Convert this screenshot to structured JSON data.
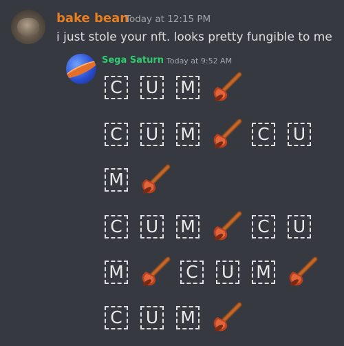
{
  "messages": [
    {
      "author": "bake bean",
      "author_color": "#e67e22",
      "timestamp": "Today at 12:15 PM",
      "text": "i just stole your nft. looks pretty fungible to me",
      "avatar_icon": "user-avatar-photo"
    },
    {
      "author": "Sega Saturn",
      "author_color": "#2ecc71",
      "timestamp": "Today at 9:52 AM",
      "avatar_icon": "saturn-planet-avatar",
      "rows": [
        [
          "C",
          "U",
          "M",
          "plunger"
        ],
        [
          "C",
          "U",
          "M",
          "plunger",
          "C",
          "U"
        ],
        [
          "M",
          "plunger"
        ],
        [
          "C",
          "U",
          "M",
          "plunger",
          "C",
          "U"
        ],
        [
          "M",
          "plunger",
          "C",
          "U",
          "M",
          "plunger"
        ],
        [
          "C",
          "U",
          "M",
          "plunger"
        ]
      ]
    }
  ],
  "colors": {
    "background": "#36393f",
    "text": "#dcddde",
    "timestamp": "#a3a6aa"
  }
}
